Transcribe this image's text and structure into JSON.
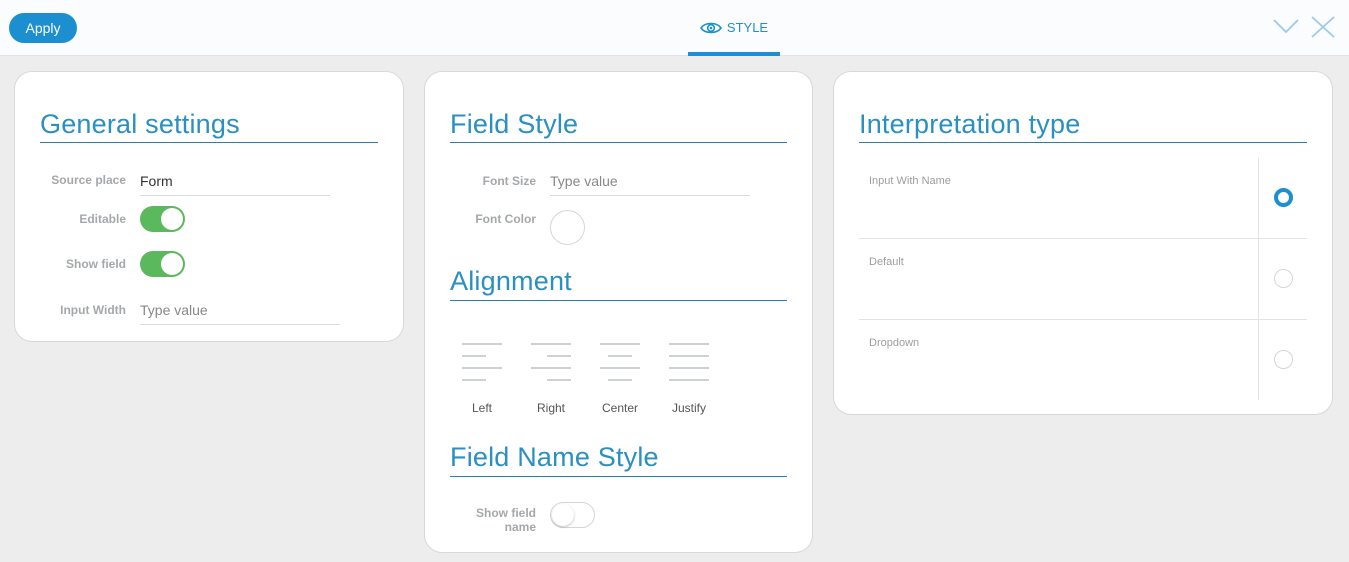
{
  "toolbar": {
    "apply_label": "Apply",
    "tab_label": "STYLE",
    "tab_icon": "eye-icon",
    "collapse_icon": "chevron-down-icon",
    "close_icon": "close-icon",
    "accent_color": "#1c8fd0"
  },
  "general": {
    "title": "General settings",
    "source_place_label": "Source place",
    "source_place_value": "Form",
    "editable_label": "Editable",
    "editable_on": true,
    "show_field_label": "Show field",
    "show_field_on": true,
    "input_width_label": "Input Width",
    "input_width_placeholder": "Type value",
    "toggle_on_color": "#5cb85c"
  },
  "field_style": {
    "title": "Field Style",
    "font_size_label": "Font Size",
    "font_size_placeholder": "Type value",
    "font_color_label": "Font Color"
  },
  "alignment": {
    "title": "Alignment",
    "options": [
      {
        "label": "Left",
        "icon": "align-left-icon"
      },
      {
        "label": "Right",
        "icon": "align-right-icon"
      },
      {
        "label": "Center",
        "icon": "align-center-icon"
      },
      {
        "label": "Justify",
        "icon": "align-justify-icon"
      }
    ]
  },
  "field_name_style": {
    "title": "Field Name Style",
    "show_field_name_label_line1": "Show field",
    "show_field_name_label_line2": "name",
    "show_field_name_on": false
  },
  "interpretation": {
    "title": "Interpretation type",
    "options": [
      {
        "label": "Input With Name",
        "selected": true
      },
      {
        "label": "Default",
        "selected": false
      },
      {
        "label": "Dropdown",
        "selected": false
      }
    ]
  }
}
